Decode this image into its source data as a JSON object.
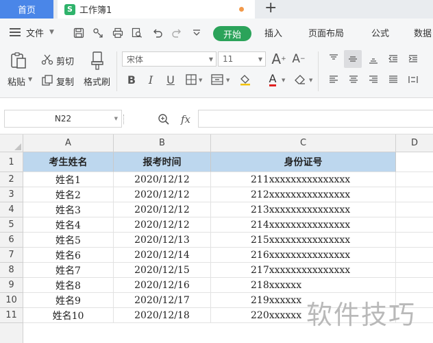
{
  "tabs": {
    "home": "首页",
    "document": "工作簿1",
    "doc_icon": "S",
    "add": "+"
  },
  "menu": {
    "file": "文件",
    "items": [
      "开始",
      "插入",
      "页面布局",
      "公式",
      "数据"
    ]
  },
  "ribbon": {
    "paste": "粘贴",
    "cut": "剪切",
    "copy": "复制",
    "format_painter": "格式刷",
    "font_name": "宋体",
    "font_size": "11",
    "bold": "B",
    "italic": "I",
    "underline": "U",
    "font_color_glyph": "A"
  },
  "formula_bar": {
    "name_box": "N22",
    "fx": "fx",
    "formula": ""
  },
  "columns": [
    "A",
    "B",
    "C",
    "D"
  ],
  "rows": [
    "1",
    "2",
    "3",
    "4",
    "5",
    "6",
    "7",
    "8",
    "9",
    "10",
    "11"
  ],
  "table": {
    "headers": [
      "考生姓名",
      "报考时间",
      "身份证号"
    ],
    "data": [
      [
        "姓名1",
        "2020/12/12",
        "211xxxxxxxxxxxxxxx"
      ],
      [
        "姓名2",
        "2020/12/12",
        "212xxxxxxxxxxxxxxx"
      ],
      [
        "姓名3",
        "2020/12/12",
        "213xxxxxxxxxxxxxxx"
      ],
      [
        "姓名4",
        "2020/12/12",
        "214xxxxxxxxxxxxxxx"
      ],
      [
        "姓名5",
        "2020/12/13",
        "215xxxxxxxxxxxxxxx"
      ],
      [
        "姓名6",
        "2020/12/14",
        "216xxxxxxxxxxxxxxx"
      ],
      [
        "姓名7",
        "2020/12/15",
        "217xxxxxxxxxxxxxxx"
      ],
      [
        "姓名8",
        "2020/12/16",
        "218xxxxxx"
      ],
      [
        "姓名9",
        "2020/12/17",
        "219xxxxxx"
      ],
      [
        "姓名10",
        "2020/12/18",
        "220xxxxxx"
      ]
    ]
  },
  "watermark": "软件技巧",
  "colors": {
    "home_tab": "#4a86e8",
    "start_button": "#2ba35a",
    "header_fill": "#bdd7ee",
    "doc_icon": "#2fb36b"
  }
}
